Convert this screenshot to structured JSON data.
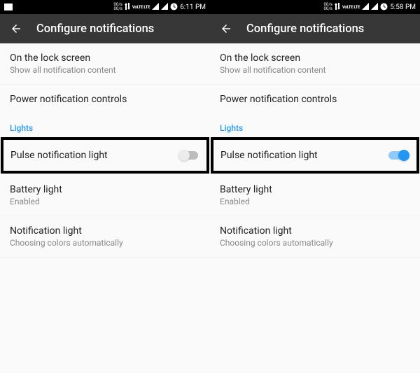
{
  "panels": [
    {
      "statusbar": {
        "kbps1": "00/s",
        "kbps2": "00/s",
        "volte": "VoLTE LTE",
        "time": "6:11 PM"
      },
      "header": {
        "title": "Configure notifications"
      },
      "settings": {
        "lockscreen": {
          "title": "On the lock screen",
          "subtitle": "Show all notification content"
        },
        "power": {
          "title": "Power notification controls"
        },
        "section_lights": "Lights",
        "pulse": {
          "title": "Pulse notification light",
          "on": false
        },
        "battery": {
          "title": "Battery light",
          "subtitle": "Enabled"
        },
        "notif": {
          "title": "Notification light",
          "subtitle": "Choosing colors automatically"
        }
      }
    },
    {
      "statusbar": {
        "kbps1": "00/s",
        "kbps2": "00/s",
        "volte": "VoLTE LTE",
        "time": "5:58 PM"
      },
      "header": {
        "title": "Configure notifications"
      },
      "settings": {
        "lockscreen": {
          "title": "On the lock screen",
          "subtitle": "Show all notification content"
        },
        "power": {
          "title": "Power notification controls"
        },
        "section_lights": "Lights",
        "pulse": {
          "title": "Pulse notification light",
          "on": true
        },
        "battery": {
          "title": "Battery light",
          "subtitle": "Enabled"
        },
        "notif": {
          "title": "Notification light",
          "subtitle": "Choosing colors automatically"
        }
      }
    }
  ]
}
